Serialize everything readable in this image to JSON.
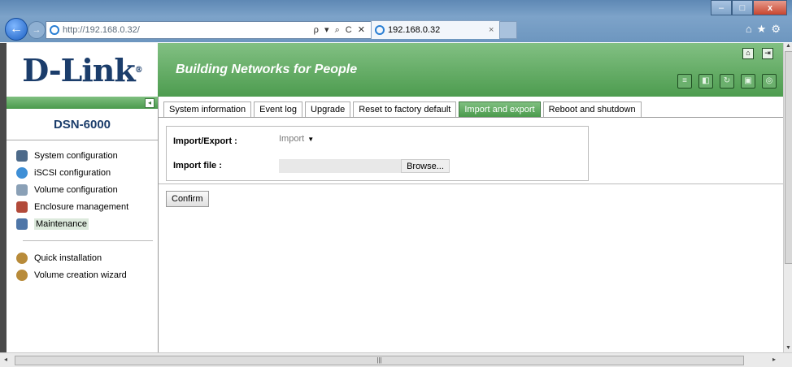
{
  "browser": {
    "url": "http://192.168.0.32/",
    "tab_title": "192.168.0.32",
    "address_controls": "ρ ▾ ⌕ C ✕",
    "tab_close": "×",
    "min": "–",
    "max": "□",
    "close": "x",
    "right_icons": "⌂★⚙"
  },
  "header": {
    "logo": "D-Link",
    "logo_mark": "®",
    "slogan": "Building Networks for People",
    "tools": [
      "disk-stack-icon",
      "network-icon",
      "refresh-icon",
      "save-icon",
      "monitor-icon"
    ]
  },
  "sidebar": {
    "model": "DSN-6000",
    "collapse_label": "◂",
    "items": [
      {
        "label": "System configuration",
        "icon": "computer-icon",
        "color": "#4d6a8a"
      },
      {
        "label": "iSCSI configuration",
        "icon": "iscsi-icon",
        "color": "#3f8fd6"
      },
      {
        "label": "Volume configuration",
        "icon": "volume-icon",
        "color": "#8aa0b6"
      },
      {
        "label": "Enclosure management",
        "icon": "enclosure-icon",
        "color": "#b24a3a"
      },
      {
        "label": "Maintenance",
        "icon": "maintenance-icon",
        "color": "#4f76a8"
      }
    ],
    "extra": [
      {
        "label": "Quick installation",
        "icon": "quick-install-icon",
        "color": "#b88b3a"
      },
      {
        "label": "Volume creation wizard",
        "icon": "wizard-icon",
        "color": "#b88b3a"
      }
    ]
  },
  "tabs": [
    {
      "label": "System information"
    },
    {
      "label": "Event log"
    },
    {
      "label": "Upgrade"
    },
    {
      "label": "Reset to factory default"
    },
    {
      "label": "Import and export",
      "active": true
    },
    {
      "label": "Reboot and shutdown"
    }
  ],
  "form": {
    "mode_label": "Import/Export :",
    "mode_value": "Import",
    "file_label": "Import file :",
    "browse_label": "Browse...",
    "confirm_label": "Confirm"
  },
  "colors": {
    "brand": "#1b3d6b",
    "banner": "#5aa65c"
  }
}
